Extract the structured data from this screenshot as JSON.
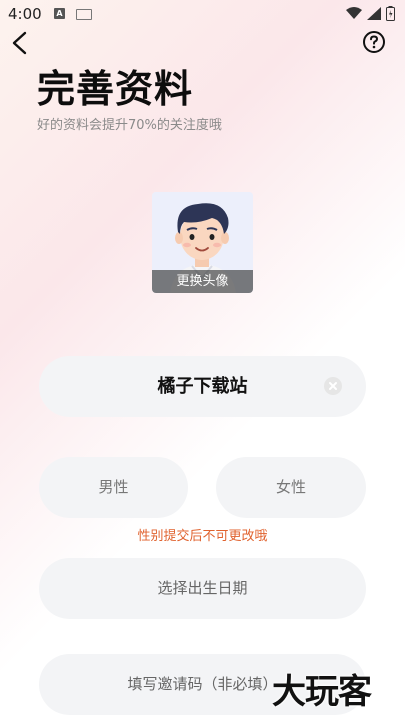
{
  "status_bar": {
    "time": "4:00",
    "a_badge": "A"
  },
  "page": {
    "title": "完善资料",
    "subtitle": "好的资料会提升70%的关注度哦"
  },
  "avatar": {
    "change_label": "更换头像"
  },
  "form": {
    "nickname_value": "橘子下载站",
    "gender_male": "男性",
    "gender_female": "女性",
    "gender_hint": "性别提交后不可更改哦",
    "birthday_placeholder": "选择出生日期",
    "invite_placeholder": "填写邀请码（非必填）"
  },
  "watermark": "大玩客",
  "colors": {
    "hint_orange": "#e0622e",
    "pill_bg": "#f3f4f6"
  }
}
